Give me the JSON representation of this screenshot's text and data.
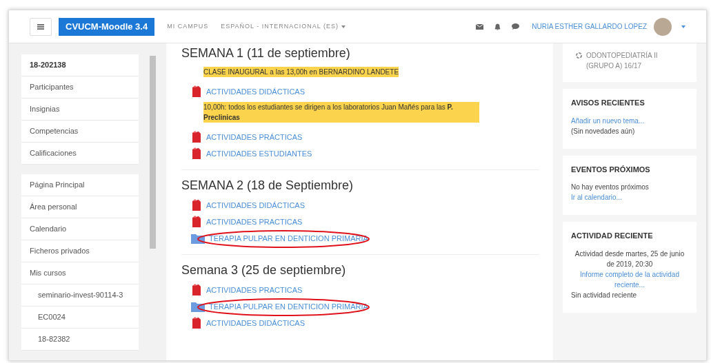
{
  "navbar": {
    "brand": "CVUCM-Moodle 3.4",
    "links": [
      {
        "label": "MI CAMPUS",
        "dropdown": false
      },
      {
        "label": "ESPAÑOL - INTERNACIONAL (ES)",
        "dropdown": true
      }
    ],
    "user_name": "NURIA ESTHER GALLARDO LOPEZ"
  },
  "sidebar": {
    "groups": [
      {
        "items": [
          {
            "label": "18-202138",
            "bold": true
          },
          {
            "label": "Participantes",
            "bold": false
          },
          {
            "label": "Insignias",
            "bold": false
          },
          {
            "label": "Competencias",
            "bold": false
          },
          {
            "label": "Calificaciones",
            "bold": false
          }
        ]
      },
      {
        "items": [
          {
            "label": "Página Principal",
            "bold": false
          },
          {
            "label": "Área personal",
            "bold": false
          },
          {
            "label": "Calendario",
            "bold": false
          },
          {
            "label": "Ficheros privados",
            "bold": false
          },
          {
            "label": "Mis cursos",
            "bold": false,
            "children": [
              {
                "label": "seminario-invest-90114-3",
                "bold": false
              },
              {
                "label": "EC0024",
                "bold": false
              },
              {
                "label": "18-82382",
                "bold": false
              }
            ]
          }
        ]
      }
    ]
  },
  "sections": [
    {
      "title": "SEMANA 1 (11 de septiembre)",
      "items": [
        {
          "kind": "note",
          "text": "CLASE INAUGURAL a las 13,00h en BERNARDINO LANDETE"
        },
        {
          "kind": "pdf",
          "text": "ACTIVIDADES DIDÁCTICAS",
          "circled": false
        },
        {
          "kind": "note",
          "text": "10,00h: todos los estudiantes se dirigen a los laboratorios Juan Mañés para las **P. Preclinicas**"
        },
        {
          "kind": "pdf",
          "text": "ACTIVIDADES PRÁCTICAS",
          "circled": false
        },
        {
          "kind": "pdf",
          "text": "ACTIVIDADES ESTUDIANTES",
          "circled": false
        }
      ]
    },
    {
      "title": "SEMANA 2 (18 de Septiembre)",
      "items": [
        {
          "kind": "pdf",
          "text": "ACTIVIDADES DIDÁCTICAS",
          "circled": false
        },
        {
          "kind": "pdf",
          "text": "ACTIVIDADES PRACTICAS",
          "circled": false
        },
        {
          "kind": "folder",
          "text": "TERAPIA PULPAR EN DENTICION PRIMARIA",
          "circled": true
        }
      ]
    },
    {
      "title": "Semana 3 (25 de septiembre)",
      "items": [
        {
          "kind": "pdf",
          "text": "ACTIVIDADES PRACTICAS",
          "circled": false
        },
        {
          "kind": "folder",
          "text": "TERAPIA PULPAR EN DENTICION PRIMARIA",
          "circled": true
        },
        {
          "kind": "pdf",
          "text": "ACTIVIDADES DIDÁCTICAS",
          "circled": false
        }
      ]
    }
  ],
  "blocks": [
    {
      "kind": "course",
      "lines": [
        {
          "kind": "course",
          "text": "ODONTOPEDIATRÍA II (GRUPO A) 16/17"
        }
      ]
    },
    {
      "kind": "card",
      "title": "AVISOS RECIENTES",
      "lines": [
        {
          "kind": "link",
          "text": "Añadir un nuevo tema..."
        },
        {
          "kind": "text",
          "text": "(Sin novedades aún)"
        }
      ]
    },
    {
      "kind": "card",
      "title": "EVENTOS PRÓXIMOS",
      "lines": [
        {
          "kind": "text",
          "text": "No hay eventos próximos"
        },
        {
          "kind": "link",
          "text": "Ir al calendario..."
        }
      ]
    },
    {
      "kind": "card",
      "title": "ACTIVIDAD RECIENTE",
      "lines": [
        {
          "kind": "centered",
          "text": "Actividad desde martes, 25 de junio de 2019, 20:30"
        },
        {
          "kind": "centered-link",
          "text": "Informe completo de la actividad reciente..."
        },
        {
          "kind": "text",
          "text": "Sin actividad reciente"
        }
      ]
    }
  ]
}
